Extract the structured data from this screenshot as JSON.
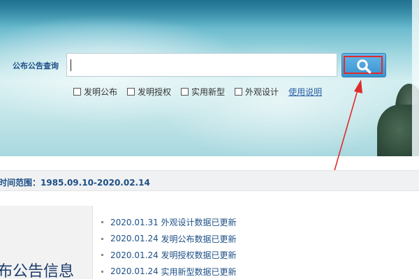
{
  "search": {
    "label": "公布公告查询",
    "value": "",
    "options": [
      {
        "label": "发明公布",
        "checked": false
      },
      {
        "label": "发明授权",
        "checked": false
      },
      {
        "label": "实用新型",
        "checked": false
      },
      {
        "label": "外观设计",
        "checked": false
      }
    ],
    "help_link": "使用说明",
    "button_icon": "search-icon"
  },
  "info": {
    "date_range": "时间范围：1985.09.10-2020.02.14"
  },
  "left_panel": {
    "title": "布公告信息"
  },
  "news": [
    {
      "date": "2020.01.31",
      "text": "外观设计数据已更新"
    },
    {
      "date": "2020.01.24",
      "text": "发明公布数据已更新"
    },
    {
      "date": "2020.01.24",
      "text": "发明授权数据已更新"
    },
    {
      "date": "2020.01.24",
      "text": "实用新型数据已更新"
    }
  ],
  "colors": {
    "accent": "#1c4f86",
    "button": "#3a93cf",
    "highlight": "#e02b2b"
  }
}
